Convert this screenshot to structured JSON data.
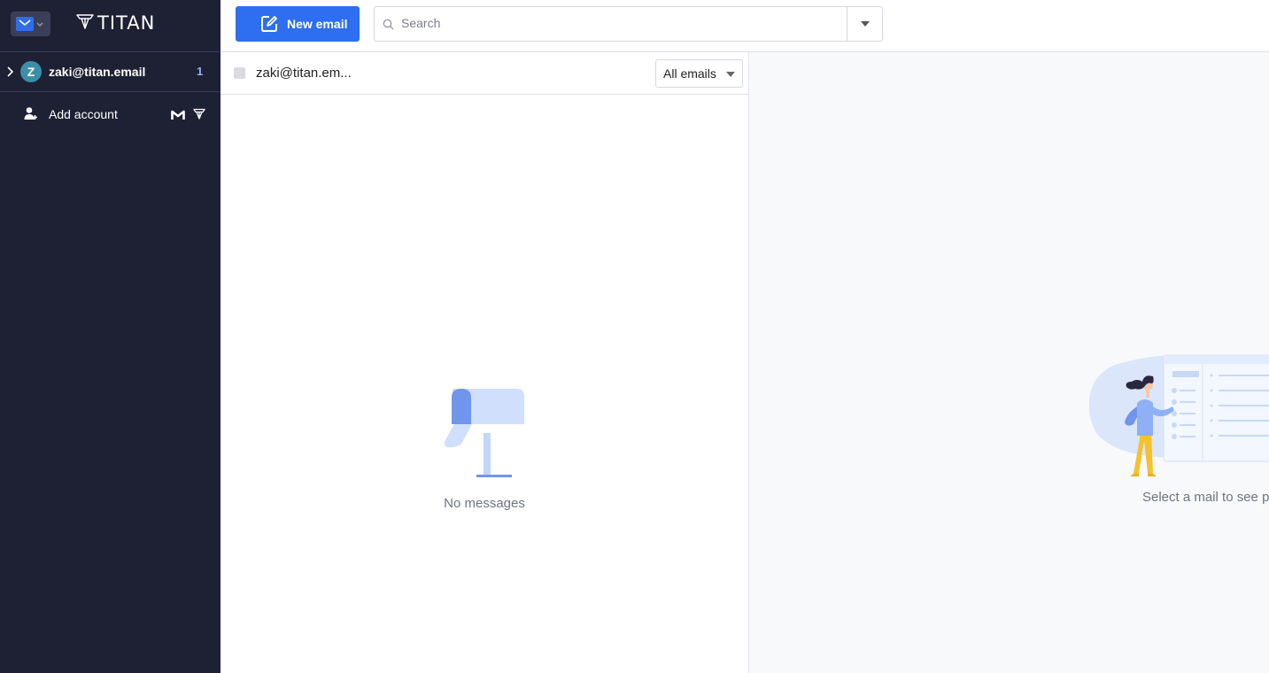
{
  "brand": {
    "name": "TITAN"
  },
  "toolbar": {
    "new_email_label": "New email"
  },
  "search": {
    "placeholder": "Search"
  },
  "sidebar": {
    "account": {
      "avatar_letter": "Z",
      "email": "zaki@titan.email",
      "unread_count": "1"
    },
    "add_account_label": "Add account"
  },
  "list": {
    "title": "zaki@titan.em...",
    "filter_label": "All emails",
    "empty_text": "No messages"
  },
  "preview": {
    "placeholder_text": "Select a mail to see p"
  },
  "icons": {
    "app_switcher": "mail-icon",
    "brand": "titan-logo-icon",
    "expand": "chevron-right-icon",
    "add_account": "add-user-icon",
    "gmail": "gmail-icon",
    "titan_small": "titan-icon",
    "compose": "compose-icon",
    "search": "search-icon",
    "search_dropdown": "caret-down-icon",
    "filter_dropdown": "caret-down-icon"
  },
  "colors": {
    "sidebar_bg": "#1e2134",
    "accent": "#2d6ff0",
    "avatar": "#3b8fa8",
    "count": "#8fb3ff"
  }
}
